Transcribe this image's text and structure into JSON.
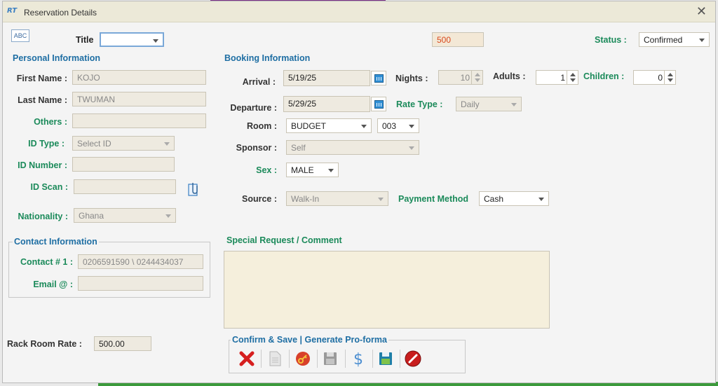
{
  "window": {
    "title": "Reservation Details"
  },
  "header": {
    "title_label": "Title",
    "title_value": "",
    "code": "500",
    "status_label": "Status :",
    "status_value": "Confirmed"
  },
  "personal": {
    "section": "Personal Information",
    "first_name_label": "First Name :",
    "first_name": "KOJO",
    "last_name_label": "Last Name :",
    "last_name": "TWUMAN",
    "others_label": "Others :",
    "others": "",
    "id_type_label": "ID Type :",
    "id_type": "Select ID",
    "id_number_label": "ID Number :",
    "id_number": "",
    "id_scan_label": "ID Scan :",
    "id_scan": "",
    "nationality_label": "Nationality :",
    "nationality": "Ghana"
  },
  "contact": {
    "section": "Contact Information",
    "contact_label": "Contact # 1 :",
    "contact": "0206591590 \\ 0244434037",
    "email_label": "Email @ :",
    "email": ""
  },
  "rack": {
    "label": "Rack Room Rate :",
    "value": "500.00"
  },
  "booking": {
    "section": "Booking Information",
    "arrival_label": "Arrival :",
    "arrival": "5/19/25",
    "departure_label": "Departure :",
    "departure": "5/29/25",
    "nights_label": "Nights :",
    "nights": "10",
    "adults_label": "Adults :",
    "adults": "1",
    "children_label": "Children :",
    "children": "0",
    "rate_type_label": "Rate Type :",
    "rate_type": "Daily",
    "room_label": "Room :",
    "room_type": "BUDGET",
    "room_number": "003",
    "sponsor_label": "Sponsor :",
    "sponsor": "Self",
    "sex_label": "Sex :",
    "sex": "MALE",
    "source_label": "Source :",
    "source": "Walk-In",
    "payment_label": "Payment Method",
    "payment": "Cash"
  },
  "comment": {
    "label": "Special Request / Comment",
    "value": ""
  },
  "actions": {
    "label": "Confirm & Save | Generate Pro-forma"
  },
  "colors": {
    "section": "#1e6ea3",
    "green_label": "#1b8a5a",
    "code_text": "#d9481c",
    "field_bg": "#eeeae0"
  },
  "icons": [
    "abc-icon",
    "dropdown-arrow-icon",
    "calendar-icon",
    "paperclip-icon",
    "close-icon",
    "delete-icon",
    "document-icon",
    "key-icon",
    "save-disk-icon",
    "dollar-icon",
    "save-green-icon",
    "cancel-icon"
  ]
}
